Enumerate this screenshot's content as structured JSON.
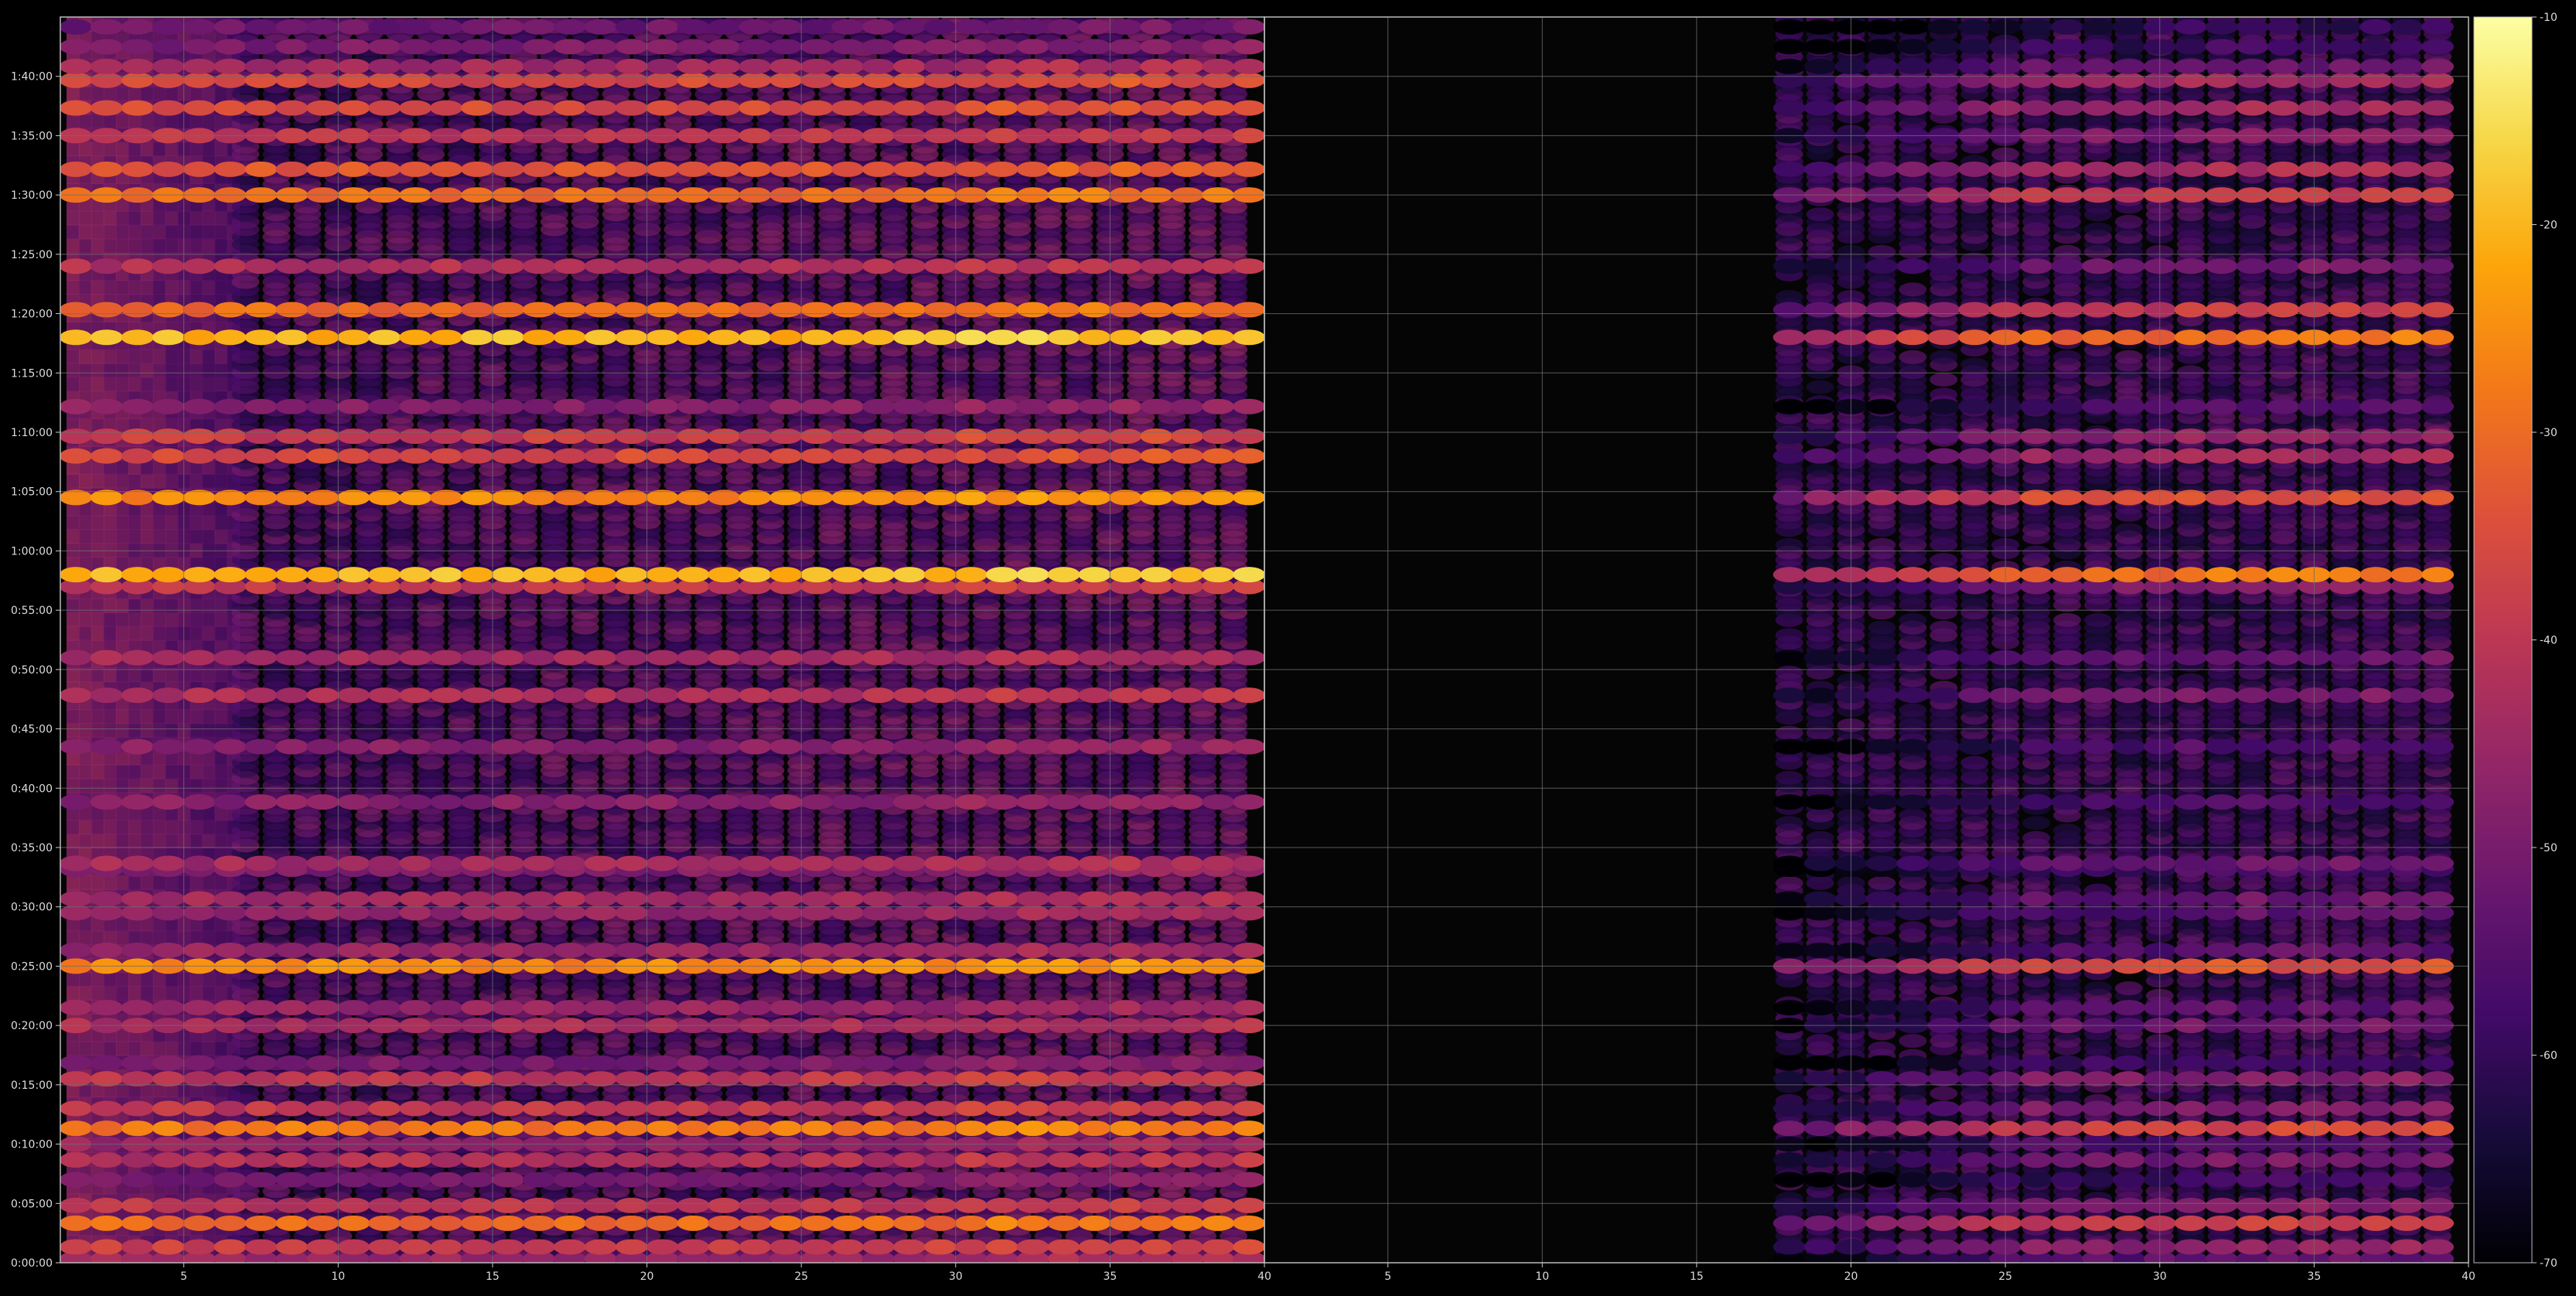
{
  "chart_data": {
    "type": "heatmap",
    "colormap": "inferno",
    "background": "#000000",
    "grid": true,
    "grid_color": "#6e6e6e",
    "title": "",
    "xlabel": "",
    "ylabel": "",
    "panels": [
      {
        "name": "left",
        "xlim": [
          1,
          40
        ],
        "xticks": [
          5,
          10,
          15,
          20,
          25,
          30,
          35,
          40
        ],
        "data_xlim": [
          1,
          40
        ],
        "gain_offset": 0,
        "row_offset": 0
      },
      {
        "name": "right",
        "xlim": [
          1,
          40
        ],
        "xticks": [
          5,
          10,
          15,
          20,
          25,
          30,
          35,
          40
        ],
        "data_xlim": [
          18,
          40
        ],
        "gain_offset": -10,
        "row_offset": 0
      }
    ],
    "y_range_seconds": [
      0,
      6300
    ],
    "yticks": [
      "0:00:00",
      "0:05:00",
      "0:10:00",
      "0:15:00",
      "0:20:00",
      "0:25:00",
      "0:30:00",
      "0:35:00",
      "0:40:00",
      "0:45:00",
      "0:50:00",
      "0:55:00",
      "1:00:00",
      "1:05:00",
      "1:10:00",
      "1:15:00",
      "1:20:00",
      "1:25:00",
      "1:30:00",
      "1:35:00",
      "1:40:00"
    ],
    "ytick_seconds": [
      0,
      300,
      600,
      900,
      1200,
      1500,
      1800,
      2100,
      2400,
      2700,
      3000,
      3300,
      3600,
      3900,
      4200,
      4500,
      4800,
      5100,
      5400,
      5700,
      6000
    ],
    "colorbar": {
      "vmin": -70,
      "vmax": -10,
      "ticks": [
        -10,
        -20,
        -30,
        -40,
        -50,
        -60,
        -70
      ]
    },
    "bands": [
      {
        "t": 20,
        "level": -45
      },
      {
        "t": 80,
        "level": -38
      },
      {
        "t": 200,
        "level": -30
      },
      {
        "t": 290,
        "level": -40
      },
      {
        "t": 420,
        "level": -50
      },
      {
        "t": 520,
        "level": -42
      },
      {
        "t": 600,
        "level": -46
      },
      {
        "t": 680,
        "level": -28
      },
      {
        "t": 780,
        "level": -40
      },
      {
        "t": 930,
        "level": -40
      },
      {
        "t": 1010,
        "level": -50
      },
      {
        "t": 1200,
        "level": -43
      },
      {
        "t": 1290,
        "level": -46
      },
      {
        "t": 1500,
        "level": -26
      },
      {
        "t": 1580,
        "level": -46
      },
      {
        "t": 1770,
        "level": -46
      },
      {
        "t": 1840,
        "level": -44
      },
      {
        "t": 1990,
        "level": -49
      },
      {
        "t": 2020,
        "level": -44
      },
      {
        "t": 2330,
        "level": -48
      },
      {
        "t": 2610,
        "level": -48
      },
      {
        "t": 2870,
        "level": -42
      },
      {
        "t": 3060,
        "level": -44
      },
      {
        "t": 3420,
        "level": -40
      },
      {
        "t": 3480,
        "level": -20
      },
      {
        "t": 3870,
        "level": -26
      },
      {
        "t": 4080,
        "level": -36
      },
      {
        "t": 4180,
        "level": -38
      },
      {
        "t": 4330,
        "level": -48
      },
      {
        "t": 4680,
        "level": -20
      },
      {
        "t": 4820,
        "level": -30
      },
      {
        "t": 5040,
        "level": -42
      },
      {
        "t": 5400,
        "level": -30
      },
      {
        "t": 5530,
        "level": -34
      },
      {
        "t": 5700,
        "level": -40
      },
      {
        "t": 5840,
        "level": -36
      },
      {
        "t": 5980,
        "level": -36
      },
      {
        "t": 6050,
        "level": -44
      },
      {
        "t": 6150,
        "level": -50
      },
      {
        "t": 6250,
        "level": -52
      }
    ]
  }
}
